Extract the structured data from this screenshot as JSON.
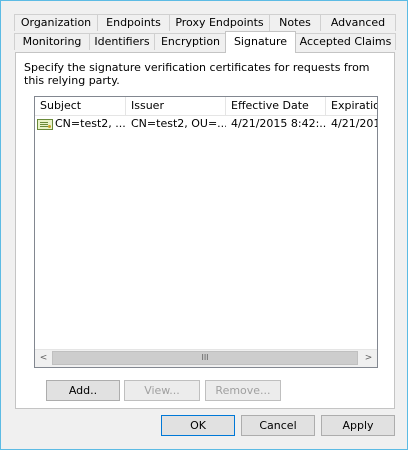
{
  "tabs_row1": [
    {
      "label": "Organization"
    },
    {
      "label": "Endpoints"
    },
    {
      "label": "Proxy Endpoints"
    },
    {
      "label": "Notes"
    },
    {
      "label": "Advanced"
    }
  ],
  "tabs_row2": [
    {
      "label": "Monitoring"
    },
    {
      "label": "Identifiers"
    },
    {
      "label": "Encryption"
    },
    {
      "label": "Signature",
      "active": true
    },
    {
      "label": "Accepted Claims"
    }
  ],
  "panel": {
    "instruction": "Specify the signature verification certificates for requests from this relying party.",
    "columns": [
      "Subject",
      "Issuer",
      "Effective Date",
      "Expiration"
    ],
    "rows": [
      {
        "icon": "certificate-icon",
        "subject": "CN=test2, ...",
        "issuer": "CN=test2, OU=...",
        "effective": "4/21/2015 8:42:...",
        "expiration": "4/21/201"
      }
    ],
    "scroll": {
      "left": "<",
      "right": ">",
      "grip": "III"
    },
    "buttons": {
      "add": "Add..",
      "view": "View...",
      "remove": "Remove..."
    }
  },
  "footer": {
    "ok": "OK",
    "cancel": "Cancel",
    "apply": "Apply"
  }
}
